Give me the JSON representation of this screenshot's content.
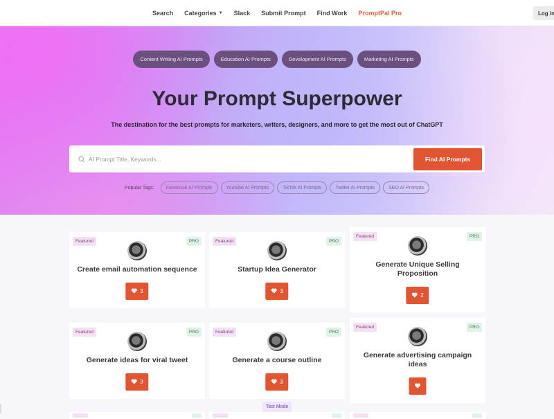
{
  "nav": {
    "links": [
      {
        "label": "Search"
      },
      {
        "label": "Categories"
      },
      {
        "label": "Slack"
      },
      {
        "label": "Submit Prompt"
      },
      {
        "label": "Find Work"
      },
      {
        "label": "PromptPal Pro"
      }
    ],
    "login_label": "Log in",
    "accent_color": "#e0603f"
  },
  "hero": {
    "categories": [
      {
        "label": "Content Writing AI Prompts"
      },
      {
        "label": "Education AI Prompts"
      },
      {
        "label": "Development AI Prompts"
      },
      {
        "label": "Marketing AI Prompts"
      }
    ],
    "title": "Your Prompt Superpower",
    "subtitle": "The destination for the best prompts for marketers, writers, designers, and more to get the most out of ChatGPT",
    "search": {
      "placeholder": "AI Prompt Title, Keywords...",
      "value": "",
      "button_label": "Find AI Prompts"
    },
    "popular_tags_label": "Popular Tags:",
    "popular_tags": [
      {
        "label": "Facebook AI Prompts"
      },
      {
        "label": "Youtube AI Prompts"
      },
      {
        "label": "TikTok AI Prompts"
      },
      {
        "label": "Twitter AI Prompts"
      },
      {
        "label": "SEO AI Prompts"
      }
    ]
  },
  "cards": [
    {
      "title": "Create email automation sequence",
      "featured": "Featured",
      "pro": "PRO",
      "likes": "3"
    },
    {
      "title": "Startup Idea Generator",
      "featured": "Featured",
      "pro": "PRO",
      "likes": "3"
    },
    {
      "title": "Generate Unique Selling Proposition",
      "featured": "Featured",
      "pro": "PRO",
      "likes": "2"
    },
    {
      "title": "Generate ideas for viral tweet",
      "featured": "Featured",
      "pro": "PRO",
      "likes": "3"
    },
    {
      "title": "Generate a course outline",
      "featured": "Featured",
      "pro": "PRO",
      "likes": "3"
    },
    {
      "title": "Generate advertising campaign ideas",
      "featured": "Featured",
      "pro": "PRO",
      "likes": ""
    }
  ],
  "test_mode_label": "Test Mode",
  "colors": {
    "button": "#e25533",
    "category_pill": "#6b4f7f",
    "featured_bg": "#f5dff3",
    "pro_bg": "#e0f3e8"
  }
}
